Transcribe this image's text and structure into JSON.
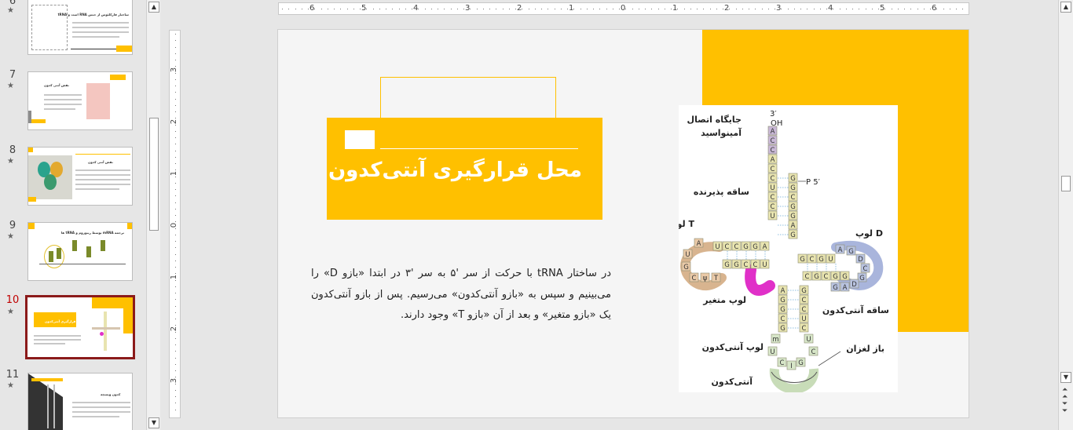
{
  "thumbnails": [
    {
      "number": "6",
      "star": "★",
      "title": "ساختار فارکلئوس از جنس RNA است و tRNA"
    },
    {
      "number": "7",
      "star": "★",
      "title": "نقش آنتی کدون"
    },
    {
      "number": "8",
      "star": "★",
      "title": "نقش آنتی کدون"
    },
    {
      "number": "9",
      "star": "★",
      "title": "ترجمه mRNA توسط ریبوزوم و tRNA ها"
    },
    {
      "number": "10",
      "star": "★",
      "title": "محل قرارگیری آنتی‌کدون"
    },
    {
      "number": "11",
      "star": "★",
      "title": "کدون ویسچه"
    }
  ],
  "rulers": {
    "horizontal": [
      "6",
      "5",
      "4",
      "3",
      "2",
      "1",
      "0",
      "1",
      "2",
      "3",
      "4",
      "5",
      "6"
    ],
    "vertical": [
      "3",
      "2",
      "1",
      "0",
      "1",
      "2",
      "3"
    ]
  },
  "slide": {
    "title": "محل قرارگیری آنتی‌کدون",
    "body": "در ساختار tRNA با حرکت از سر '۵ به سر '۳ در ابتدا «بازو D» را می‌بینیم و سپس به «بازو آنتی‌کدون» می‌رسیم. پس از بازو آنتی‌کدون یک «بازو متغیر» و بعد از آن «بازو T» وجود دارند."
  },
  "figure": {
    "labels": {
      "three_prime": "3′",
      "oh": "OH",
      "amino_site": [
        "جایگاه اتصال",
        "آمینواسید"
      ],
      "acceptor_stem": "ساقه پذیرنده",
      "p5": "P  5′",
      "t_loop": "لوپ T",
      "d_loop": "لوپ D",
      "variable_loop": "لوپ متغیر",
      "anticodon_stem": "ساقه آنتی‌کدون",
      "anticodon_loop": "لوپ آنتی‌کدون",
      "wobble": "باز لغزان",
      "anticodon": "آنتی‌کدون"
    },
    "acac": [
      "A",
      "C",
      "C"
    ],
    "acceptor_left": [
      "A",
      "C",
      "C",
      "U",
      "C",
      "C",
      "U"
    ],
    "acceptor_right": [
      "G",
      "G",
      "C",
      "G",
      "G",
      "A",
      "G"
    ],
    "t_stem_top": [
      "U",
      "C",
      "C",
      "G",
      "G",
      "A"
    ],
    "t_stem_bottom": [
      "G",
      "G",
      "C",
      "C",
      "U"
    ],
    "t_loop_bases": [
      "A",
      "U",
      "G",
      "C",
      "ψ",
      "T"
    ],
    "d_stem_top": [
      "G",
      "C",
      "G",
      "U"
    ],
    "d_stem_bottom": [
      "C",
      "G",
      "C",
      "G",
      "G"
    ],
    "d_loop_bases": [
      "A",
      "G",
      "D",
      "C",
      "G",
      "D",
      "A",
      "G"
    ],
    "anticodon_stem_left": [
      "A",
      "G",
      "G",
      "C",
      "G"
    ],
    "anticodon_stem_right": [
      "G",
      "C",
      "C",
      "U",
      "C"
    ],
    "anticodon_loop_bases": [
      "U",
      "C",
      "G",
      "I",
      "C",
      "U",
      "m"
    ],
    "colors": {
      "acceptor": "#e8e4b0",
      "t_arm": "#e9c9a7",
      "d_arm": "#b9c3e0",
      "anticodon": "#d7e6c8",
      "variable": "#e030c8",
      "amino": "#c9b8d6"
    }
  },
  "colors": {
    "accent": "#ffc000",
    "selected_border": "#8b1a1a",
    "slide_bg": "#f5f5f5"
  }
}
